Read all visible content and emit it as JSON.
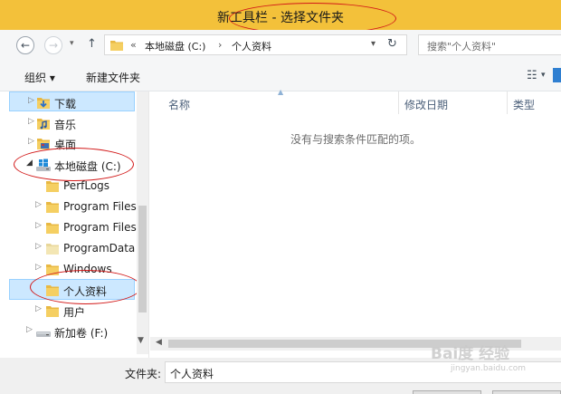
{
  "window": {
    "title": "新工具栏 - 选择文件夹"
  },
  "address_bar": {
    "back_label": "←",
    "forward_label": "→",
    "up_label": "↑",
    "path_prefix": "«",
    "breadcrumbs": [
      "本地磁盘 (C:)",
      "个人资料"
    ],
    "separator": "›",
    "search_placeholder": "搜索\"个人资料\""
  },
  "toolbar": {
    "organize_label": "组织 ▾",
    "new_folder_label": "新建文件夹"
  },
  "nav_tree": [
    {
      "label": "下载",
      "icon": "download-folder-icon",
      "arrow": "▷",
      "selected": true
    },
    {
      "label": "音乐",
      "icon": "music-folder-icon",
      "arrow": "▷"
    },
    {
      "label": "桌面",
      "icon": "desktop-folder-icon",
      "arrow": "▷"
    },
    {
      "label": "本地磁盘 (C:)",
      "icon": "windows-drive-icon",
      "arrow": "◢",
      "expanded": true
    },
    {
      "label": "PerfLogs",
      "icon": "folder-icon",
      "arrow": ""
    },
    {
      "label": "Program Files",
      "icon": "folder-icon",
      "arrow": "▷"
    },
    {
      "label": "Program Files",
      "icon": "folder-icon",
      "arrow": "▷"
    },
    {
      "label": "ProgramData",
      "icon": "folder-icon",
      "arrow": "▷"
    },
    {
      "label": "Windows",
      "icon": "folder-icon",
      "arrow": "▷"
    },
    {
      "label": "个人资料",
      "icon": "folder-icon",
      "arrow": "",
      "selected": true
    },
    {
      "label": "用户",
      "icon": "folder-icon",
      "arrow": "▷"
    },
    {
      "label": "新加卷 (F:)",
      "icon": "drive-icon",
      "arrow": "▷"
    }
  ],
  "content": {
    "columns": [
      "名称",
      "修改日期",
      "类型"
    ],
    "empty_message": "没有与搜索条件匹配的项。"
  },
  "footer": {
    "folder_label": "文件夹:",
    "folder_value": "个人资料"
  },
  "watermark": {
    "main": "Bai度 经验",
    "sub": "jingyan.baidu.com"
  },
  "colors": {
    "titlebar": "#f3c13a",
    "selection": "#cce8ff",
    "annotation": "#d21818"
  }
}
